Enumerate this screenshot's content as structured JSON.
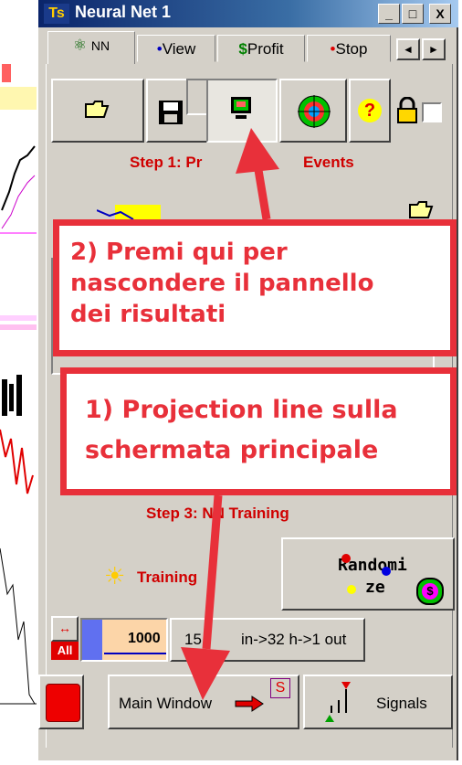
{
  "window": {
    "title": "Neural Net 1",
    "logo": "Ts",
    "min": "_",
    "max": "□",
    "close": "X"
  },
  "tabs": [
    {
      "label": "NN",
      "icon": "nn-icon"
    },
    {
      "label": "View",
      "bullet": "•"
    },
    {
      "label": "Profit",
      "prefix": "$"
    },
    {
      "label": "Stop",
      "bullet": "•"
    }
  ],
  "tab_scroll": {
    "left": "◄",
    "right": "►"
  },
  "toolbar": {
    "icons": [
      "open-folder-icon",
      "save-disk-icon",
      "monitor-icon",
      "target-icon",
      "help-icon",
      "lock-icon"
    ],
    "help_label": "?"
  },
  "step1": {
    "label": "Step 1: Pr",
    "label_tail": "Events"
  },
  "step3": {
    "label": "Step 3: NN Training"
  },
  "training": {
    "label": "Training"
  },
  "randomize": {
    "label_line1": "Randomi",
    "label_line2": "ze"
  },
  "range": {
    "all_label": "All",
    "value": "1000",
    "arch_prefix": "15",
    "arch_suffix": "in->32 h->1 out"
  },
  "bottom": {
    "main_window": "Main Window",
    "s_label": "S",
    "signals": "Signals"
  },
  "callouts": {
    "top": {
      "line1": "2) Premi qui per",
      "line2": "nascondere il pannello",
      "line3": "dei risultati"
    },
    "bottom": {
      "line1": "1) Projection line sulla",
      "line2": "schermata principale"
    }
  },
  "colors": {
    "accent_red": "#e8303a",
    "step_red": "#d00000",
    "title_blue": "#0a246a"
  }
}
